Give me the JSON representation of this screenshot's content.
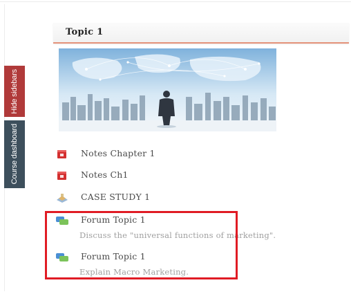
{
  "sidebar_tabs": {
    "hide_label": "Hide sidebars",
    "dashboard_label": "Course dashboard"
  },
  "topic": {
    "title": "Topic 1"
  },
  "activities": [
    {
      "label": "Notes Chapter 1",
      "icon": "pdf-file-icon"
    },
    {
      "label": "Notes Ch1",
      "icon": "pdf-file-icon"
    },
    {
      "label": "CASE STUDY 1",
      "icon": "assignment-icon"
    },
    {
      "label": "Forum Topic 1",
      "icon": "forum-icon",
      "description": "Discuss the \"universal functions of marketing\"."
    },
    {
      "label": "Forum Topic 1",
      "icon": "forum-icon",
      "description": "Explain Macro Marketing."
    }
  ],
  "colors": {
    "hide_tab": "#b03a3a",
    "dashboard_tab": "#3d4f5c",
    "header_accent": "#e4927a",
    "highlight_box": "#e01b24"
  }
}
